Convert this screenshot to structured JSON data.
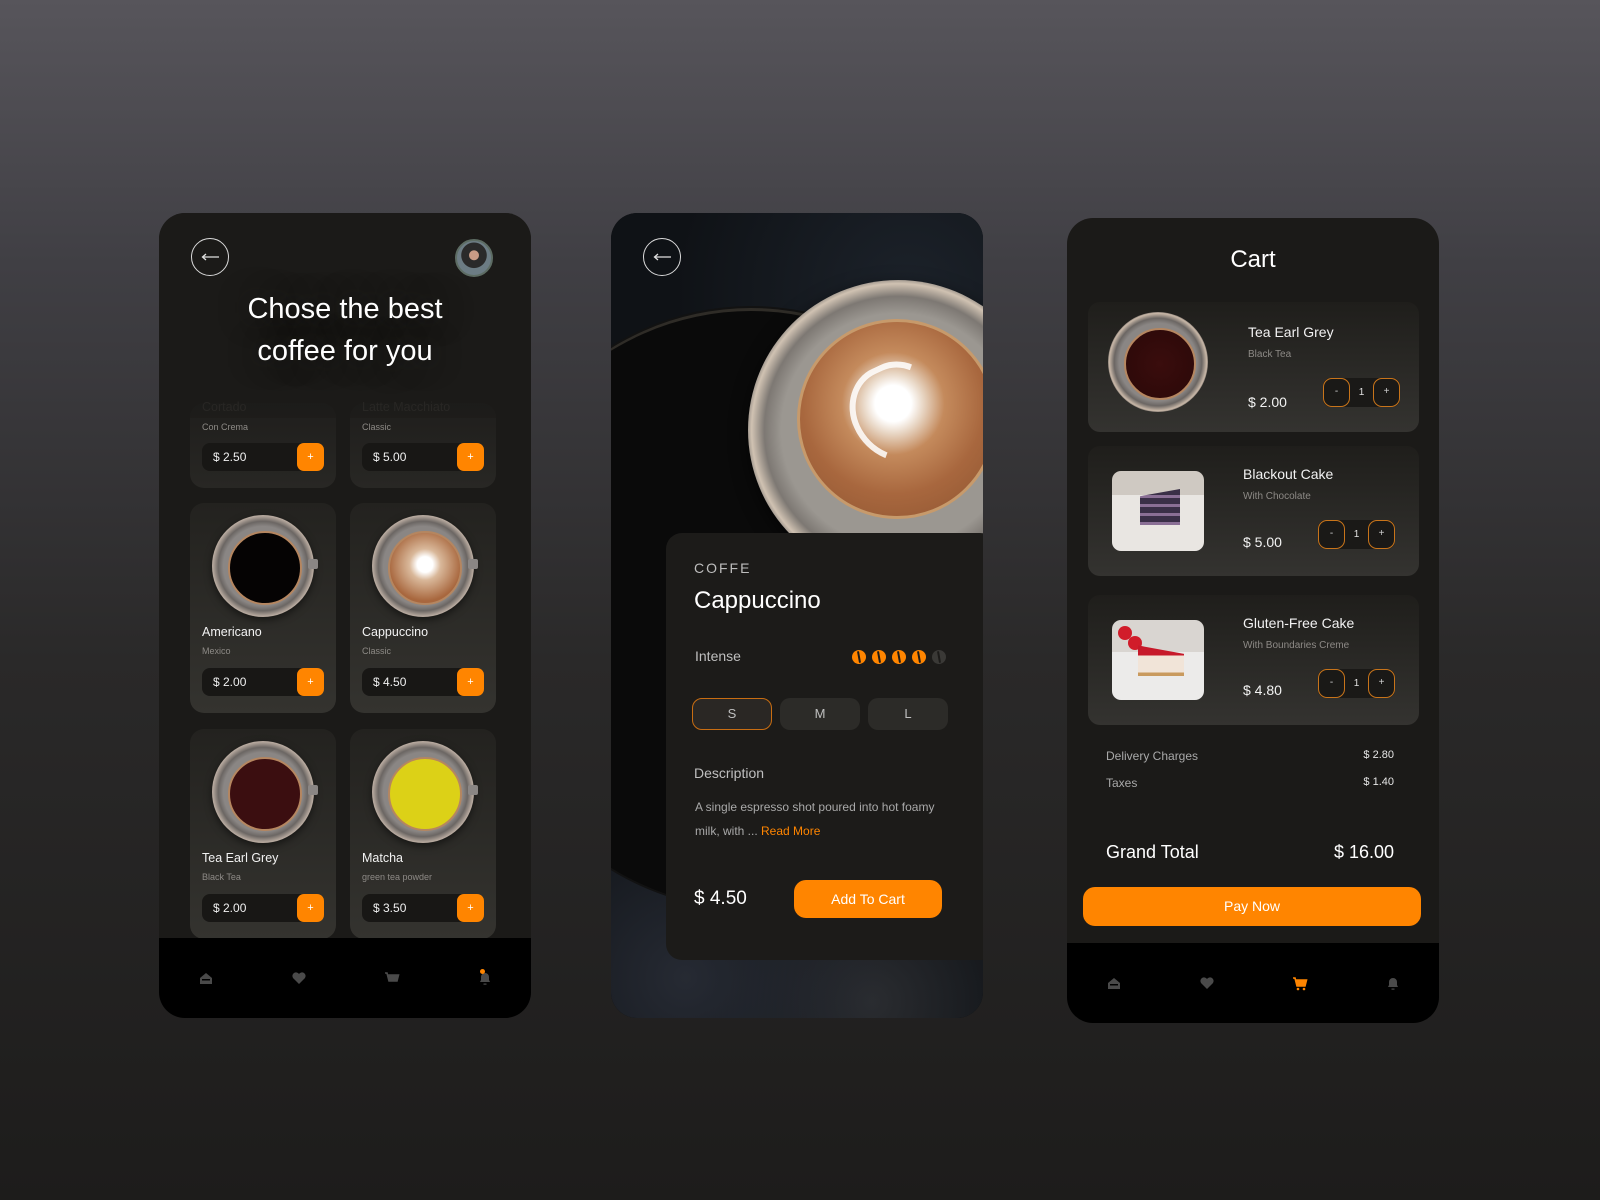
{
  "theme": {
    "accent": "#ff8500",
    "inactive_icon": "#4a4a4a"
  },
  "menu_screen": {
    "title_line1": "Chose the best",
    "title_line2": "coffee for you",
    "products": [
      {
        "name": "Cortado",
        "subtitle": "Con Crema",
        "price": "$ 2.50",
        "add": "+",
        "drink": "#2a1a10"
      },
      {
        "name": "Latte Macchiato",
        "subtitle": "Classic",
        "price": "$ 5.00",
        "add": "+",
        "drink": "#b07a4e"
      },
      {
        "name": "Americano",
        "subtitle": "Mexico",
        "price": "$ 2.00",
        "add": "+",
        "drink": "#050303"
      },
      {
        "name": "Cappuccino",
        "subtitle": "Classic",
        "price": "$ 4.50",
        "add": "+",
        "drink": "radial-gradient(circle at 50% 45%,#fff 0 15%,#d9b89a 30%,#a8673e 70%)"
      },
      {
        "name": "Tea Earl Grey",
        "subtitle": "Black Tea",
        "price": "$ 2.00",
        "add": "+",
        "drink": "#3b0e10"
      },
      {
        "name": "Matcha",
        "subtitle": "green tea powder",
        "price": "$ 3.50",
        "add": "+",
        "drink": "#dcd117"
      }
    ],
    "nav": [
      {
        "icon": "home-icon",
        "active": false
      },
      {
        "icon": "heart-icon",
        "active": false
      },
      {
        "icon": "cart-icon",
        "active": false
      },
      {
        "icon": "bell-icon",
        "active": false,
        "badge": true
      }
    ]
  },
  "detail_screen": {
    "category": "COFFE",
    "name": "Cappuccino",
    "intensity_label": "Intense",
    "intensity": {
      "value": 4,
      "max": 5
    },
    "sizes": [
      "S",
      "M",
      "L"
    ],
    "selected_size": "S",
    "description_heading": "Description",
    "description": "A single espresso shot poured into hot foamy milk, with  ... ",
    "read_more": "Read More",
    "price": "$ 4.50",
    "add_to_cart": "Add To Cart"
  },
  "cart_screen": {
    "title": "Cart",
    "items": [
      {
        "name": "Tea Earl Grey",
        "subtitle": "Black Tea",
        "price": "$ 2.00",
        "qty": "1"
      },
      {
        "name": "Blackout Cake",
        "subtitle": "With Chocolate",
        "price": "$ 5.00",
        "qty": "1"
      },
      {
        "name": "Gluten-Free Cake",
        "subtitle": "With Boundaries Creme",
        "price": "$ 4.80",
        "qty": "1"
      }
    ],
    "stepper": {
      "minus": "-",
      "plus": "+"
    },
    "delivery_label": "Delivery Charges",
    "delivery_value": "$ 2.80",
    "taxes_label": "Taxes",
    "taxes_value": "$ 1.40",
    "grand_total_label": "Grand Total",
    "grand_total_value": "$ 16.00",
    "pay_now": "Pay Now",
    "nav": [
      {
        "icon": "home-icon",
        "active": false
      },
      {
        "icon": "heart-icon",
        "active": false
      },
      {
        "icon": "cart-icon",
        "active": true
      },
      {
        "icon": "bell-icon",
        "active": false
      }
    ]
  }
}
